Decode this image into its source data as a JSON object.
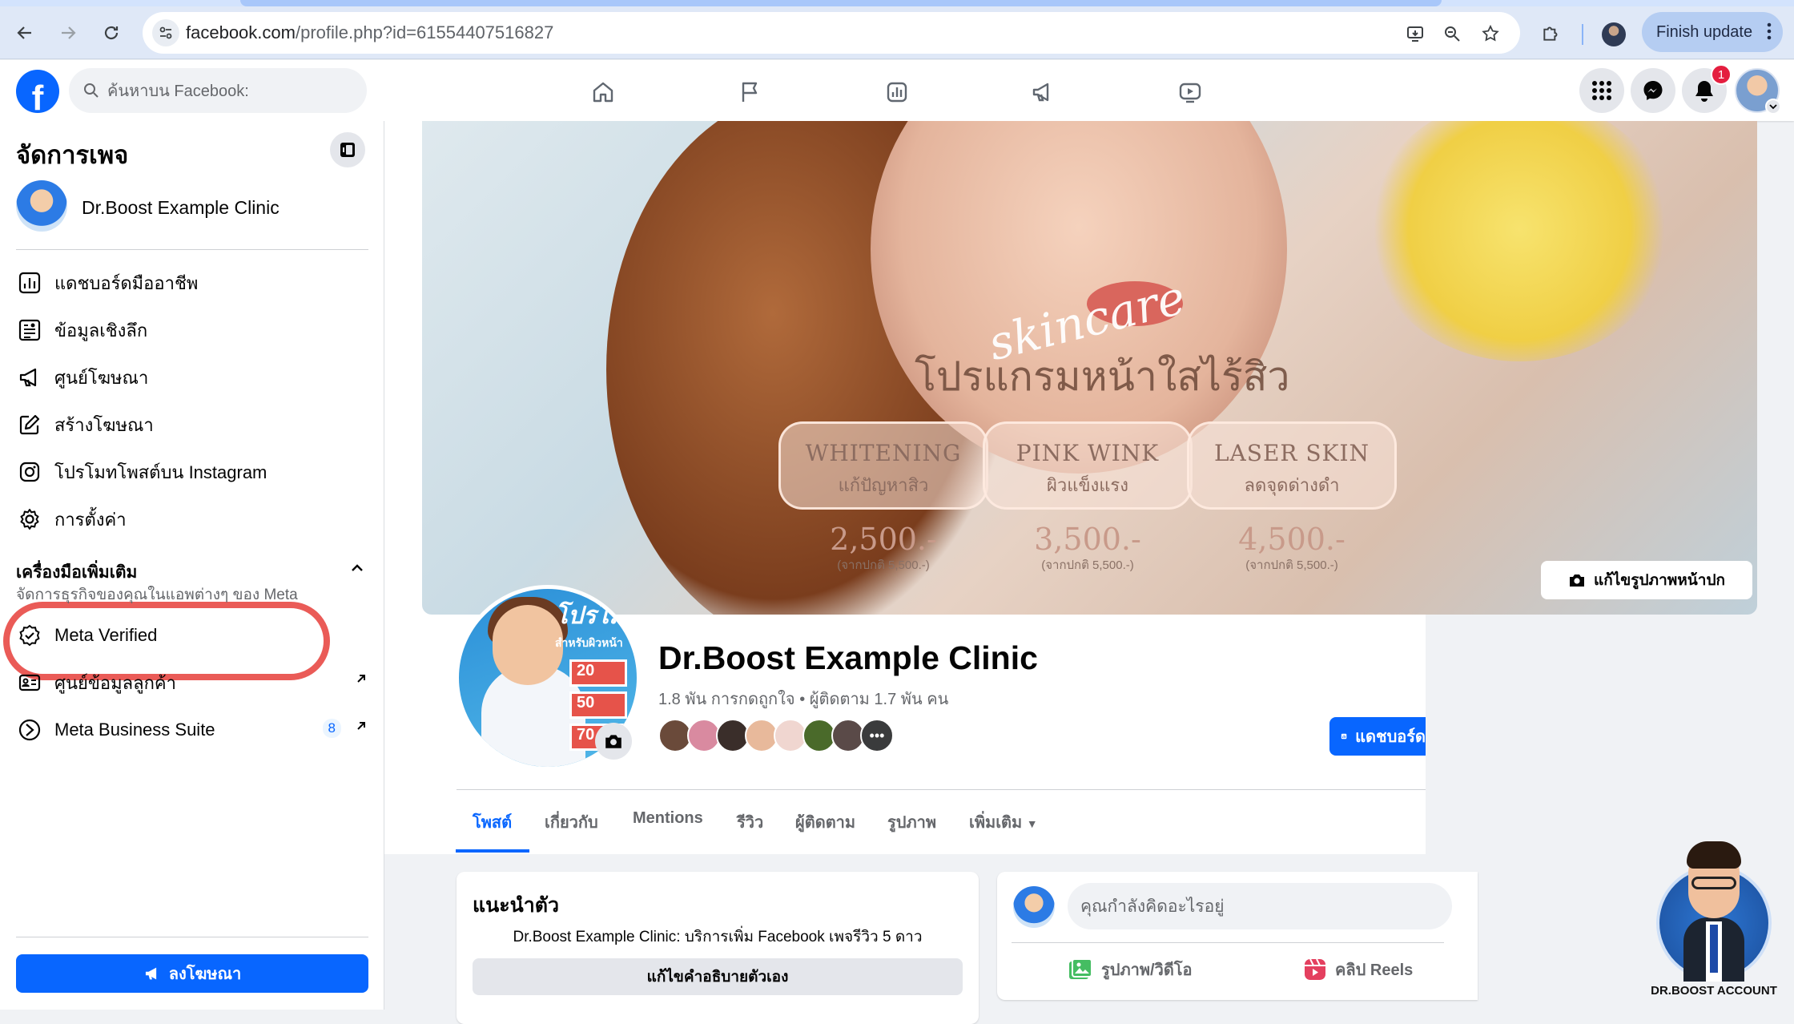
{
  "browser": {
    "url_host": "facebook.com",
    "url_path": "/profile.php?id=61554407516827",
    "finish_update": "Finish update"
  },
  "topbar": {
    "search_placeholder": "ค้นหาบน Facebook:",
    "notification_count": "1"
  },
  "sidebar": {
    "title": "จัดการเพจ",
    "page_name": "Dr.Boost Example Clinic",
    "items": [
      {
        "label": "แดชบอร์ดมืออาชีพ",
        "icon": "dashboard-icon"
      },
      {
        "label": "ข้อมูลเชิงลึก",
        "icon": "insights-icon"
      },
      {
        "label": "ศูนย์โฆษณา",
        "icon": "megaphone-icon"
      },
      {
        "label": "สร้างโฆษณา",
        "icon": "edit-icon"
      },
      {
        "label": "โปรโมทโพสต์บน Instagram",
        "icon": "instagram-icon"
      },
      {
        "label": "การตั้งค่า",
        "icon": "gear-icon"
      }
    ],
    "tools_title": "เครื่องมือเพิ่มเติม",
    "tools_subtitle": "จัดการธุรกิจของคุณในแอพต่างๆ ของ Meta",
    "tools": [
      {
        "label": "Meta Verified",
        "icon": "verified-icon"
      },
      {
        "label": "ศูนย์ข้อมูลลูกค้า",
        "icon": "contact-card-icon"
      },
      {
        "label": "Meta Business Suite",
        "icon": "business-suite-icon",
        "count": "8"
      }
    ],
    "ad_button": "ลงโฆษณา"
  },
  "cover": {
    "script": "skincare",
    "promo": "โปรแกรมหน้าใสไร้สิว",
    "pills": [
      {
        "name": "WHITENING",
        "sub": "แก้ปัญหาสิว",
        "price": "2,500.-",
        "note": "(จากปกติ 5,500.-)"
      },
      {
        "name": "PINK WINK",
        "sub": "ผิวแข็งแรง",
        "price": "3,500.-",
        "note": "(จากปกติ 5,500.-)"
      },
      {
        "name": "LASER SKIN",
        "sub": "ลดจุดด่างดำ",
        "price": "4,500.-",
        "note": "(จากปกติ 5,500.-)"
      }
    ],
    "edit_cover": "แก้ไขรูปภาพหน้าปก"
  },
  "profile": {
    "pic_banner": "โปรโม",
    "pic_sub": "สำหรับผิวหน้า",
    "pic_tags": [
      "20",
      "50",
      "70"
    ],
    "name": "Dr.Boost Example Clinic",
    "stats": "1.8 พัน การกดถูกใจ • ผู้ติดตาม 1.7 พัน คน",
    "dashboard_button": "แดชบอร์ด"
  },
  "tabs": [
    "โพสต์",
    "เกี่ยวกับ",
    "Mentions",
    "รีวิว",
    "ผู้ติดตาม",
    "รูปภาพ",
    "เพิ่มเติม"
  ],
  "intro": {
    "title": "แนะนำตัว",
    "text": "Dr.Boost Example Clinic: บริการเพิ่ม Facebook เพจรีวิว 5 ดาว",
    "edit_bio": "แก้ไขคำอธิบายตัวเอง"
  },
  "composer": {
    "placeholder": "คุณกำลังคิดอะไรอยู่",
    "photo": "รูปภาพ/วิดีโอ",
    "reels": "คลิป Reels"
  },
  "mascot_label": "DR.BOOST ACCOUNT",
  "colors": {
    "accent": "#0866ff",
    "annotation": "#ea5b57"
  }
}
